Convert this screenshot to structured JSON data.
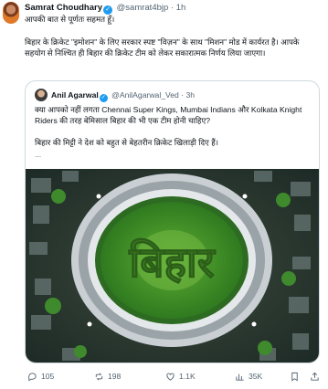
{
  "tweet": {
    "author_name": "Samrat Choudhary",
    "handle": "@samrat4bjp",
    "separator": "·",
    "time": "1h",
    "line1": "आपकी बात से पूर्णतः सहमत हूँ।",
    "line2": "बिहार के क्रिकेट \"इमोशन\" के लिए सरकार स्पष्ट \"विज़न\" के साथ \"मिशन\" मोड में कार्यरत है। आपके सहयोग से निश्चित ही बिहार की क्रिकेट टीम को लेकर सकारात्मक निर्णय लिया जाएगा।"
  },
  "quote": {
    "author_name": "Anil Agarwal",
    "handle": "@AnilAgarwal_Ved",
    "separator": "·",
    "time": "3h",
    "line1": "क्या आपको नहीं लगता Chennai Super Kings, Mumbai Indians और Kolkata Knight Riders की तरह बेमिसाल बिहार की भी एक टीम होनी चाहिए?",
    "line2": "बिहार की मिट्टी ने देश को बहुत से बेहतरीन क्रिकेट खिलाड़ी दिए हैं।",
    "line3": "...",
    "image_text": "बिहार"
  },
  "actions": {
    "replies": "105",
    "reposts": "198",
    "likes": "1.1K",
    "views": "35K"
  },
  "icons": {
    "verified": "verified-badge-icon",
    "reply": "reply-icon",
    "repost": "repost-icon",
    "like": "heart-icon",
    "views": "views-icon",
    "bookmark": "bookmark-icon",
    "share": "share-icon"
  },
  "colors": {
    "verified": "#1d9bf0",
    "text": "#0f1419",
    "secondary": "#536471",
    "border": "#cfd9de"
  }
}
